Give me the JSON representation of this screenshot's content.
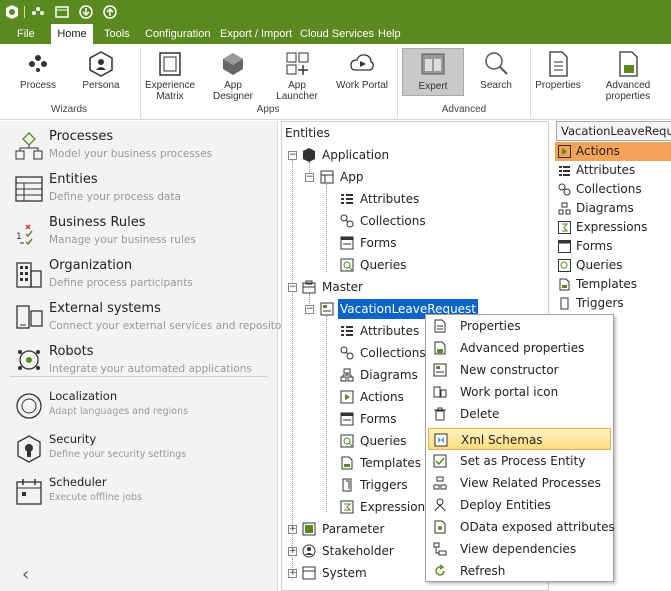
{
  "menubar": {
    "items": [
      "File",
      "Home",
      "Tools",
      "Configuration",
      "Export / Import",
      "Cloud Services",
      "Help"
    ],
    "active": "Home"
  },
  "ribbon": {
    "buttons": {
      "process": "Process",
      "persona": "Persona",
      "experience_matrix": "Experience Matrix",
      "app_designer": "App Designer",
      "app_launcher": "App Launcher",
      "work_portal": "Work Portal",
      "expert": "Expert",
      "search": "Search",
      "properties": "Properties",
      "advanced_properties": "Advanced properties"
    },
    "groups": {
      "wizards": "Wizards",
      "apps": "Apps",
      "advanced": "Advanced"
    }
  },
  "nav": {
    "items": [
      {
        "title": "Processes",
        "subtitle": "Model your business processes"
      },
      {
        "title": "Entities",
        "subtitle": "Define your process data"
      },
      {
        "title": "Business Rules",
        "subtitle": "Manage your business rules"
      },
      {
        "title": "Organization",
        "subtitle": "Define process participants"
      },
      {
        "title": "External systems",
        "subtitle": "Connect your external services and repositories"
      },
      {
        "title": "Robots",
        "subtitle": "Integrate your automated applications"
      },
      {
        "title": "Localization",
        "subtitle": "Adapt languages and regions"
      },
      {
        "title": "Security",
        "subtitle": "Define your security settings"
      },
      {
        "title": "Scheduler",
        "subtitle": "Execute offline jobs"
      }
    ]
  },
  "tree": {
    "header": "Entities",
    "application": "Application",
    "app": "App",
    "app_children": [
      "Attributes",
      "Collections",
      "Forms",
      "Queries"
    ],
    "master": "Master",
    "selected_entity": "VacationLeaveRequest",
    "entity_children": [
      "Attributes",
      "Collections",
      "Diagrams",
      "Actions",
      "Forms",
      "Queries",
      "Templates",
      "Triggers",
      "Expressions"
    ],
    "parameter": "Parameter",
    "stakeholder": "Stakeholder",
    "system": "System"
  },
  "right_panel": {
    "header": "VacationLeaveRequest",
    "items": [
      "Actions",
      "Attributes",
      "Collections",
      "Diagrams",
      "Expressions",
      "Forms",
      "Queries",
      "Templates",
      "Triggers"
    ],
    "selected": "Actions",
    "selected_color": "#f6a35a"
  },
  "context_menu": {
    "items": [
      "Properties",
      "Advanced properties",
      "New constructor",
      "Work portal icon",
      "Delete",
      "Xml Schemas",
      "Set as Process Entity",
      "View Related Processes",
      "Deploy Entities",
      "OData exposed attributes",
      "View dependencies",
      "Refresh"
    ],
    "highlighted": "Xml Schemas"
  },
  "colors": {
    "titlebar": "#5a8a1f",
    "selection": "#0a64c8",
    "menu_hover": "#fddc7a"
  }
}
